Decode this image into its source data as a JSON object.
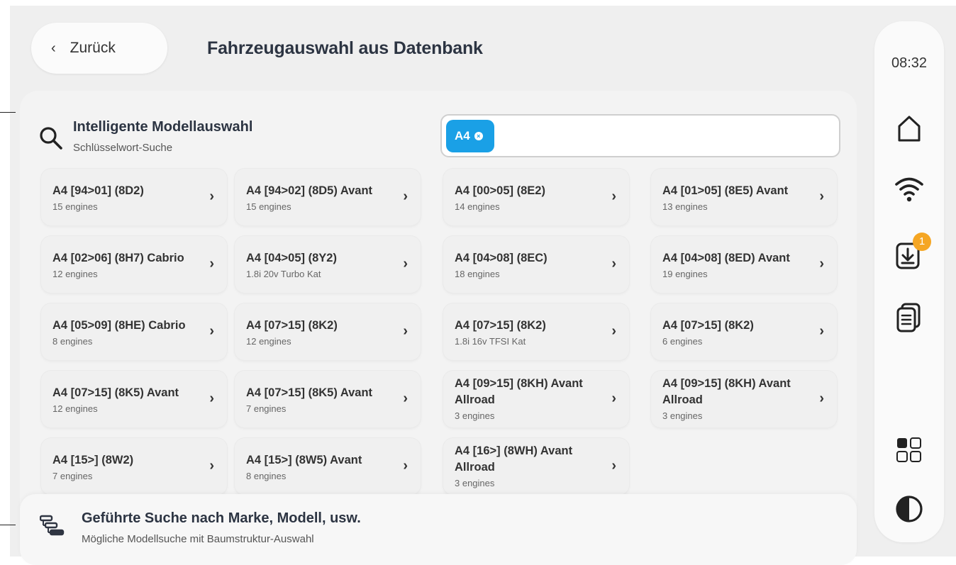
{
  "header": {
    "back_label": "Zurück",
    "title": "Fahrzeugauswahl aus Datenbank"
  },
  "smart_search": {
    "title": "Intelligente Modellauswahl",
    "subtitle": "Schlüsselwort-Suche",
    "chip": "A4"
  },
  "models": [
    {
      "name": "A4  [94>01] (8D2)",
      "sub": "15 engines"
    },
    {
      "name": "A4  [94>02] (8D5) Avant",
      "sub": "15 engines"
    },
    {
      "name": "A4 [00>05] (8E2)",
      "sub": "14 engines"
    },
    {
      "name": "A4 [01>05] (8E5) Avant",
      "sub": "13 engines"
    },
    {
      "name": "A4 [02>06] (8H7) Cabrio",
      "sub": "12 engines"
    },
    {
      "name": "A4 [04>05] (8Y2)",
      "sub": "1.8i 20v Turbo Kat"
    },
    {
      "name": "A4 [04>08] (8EC)",
      "sub": "18 engines"
    },
    {
      "name": "A4 [04>08] (8ED) Avant",
      "sub": "19 engines"
    },
    {
      "name": "A4 [05>09] (8HE) Cabrio",
      "sub": "8 engines"
    },
    {
      "name": "A4 [07>15] (8K2)",
      "sub": "12 engines"
    },
    {
      "name": "A4 [07>15] (8K2)",
      "sub": "1.8i 16v TFSI Kat"
    },
    {
      "name": "A4 [07>15] (8K2)",
      "sub": "6 engines"
    },
    {
      "name": "A4 [07>15] (8K5) Avant",
      "sub": "12 engines"
    },
    {
      "name": "A4 [07>15] (8K5) Avant",
      "sub": "7 engines"
    },
    {
      "name": "A4 [09>15] (8KH) Avant Allroad",
      "sub": "3 engines"
    },
    {
      "name": "A4 [09>15] (8KH) Avant Allroad",
      "sub": "3 engines"
    },
    {
      "name": "A4 [15>] (8W2)",
      "sub": "7 engines"
    },
    {
      "name": "A4 [15>] (8W5) Avant",
      "sub": "8 engines"
    },
    {
      "name": "A4 [16>] (8WH) Avant Allroad",
      "sub": "3 engines"
    }
  ],
  "guided_search": {
    "title": "Geführte Suche nach Marke, Modell, usw.",
    "subtitle": "Mögliche Modellsuche mit Baumstruktur-Auswahl"
  },
  "sidebar": {
    "time": "08:32",
    "download_badge": "1",
    "icons": [
      "home-icon",
      "wifi-icon",
      "download-icon",
      "documents-icon",
      "apps-grid-icon",
      "contrast-icon"
    ]
  },
  "colors": {
    "accent": "#1aa0e6",
    "badge": "#f5a623"
  }
}
